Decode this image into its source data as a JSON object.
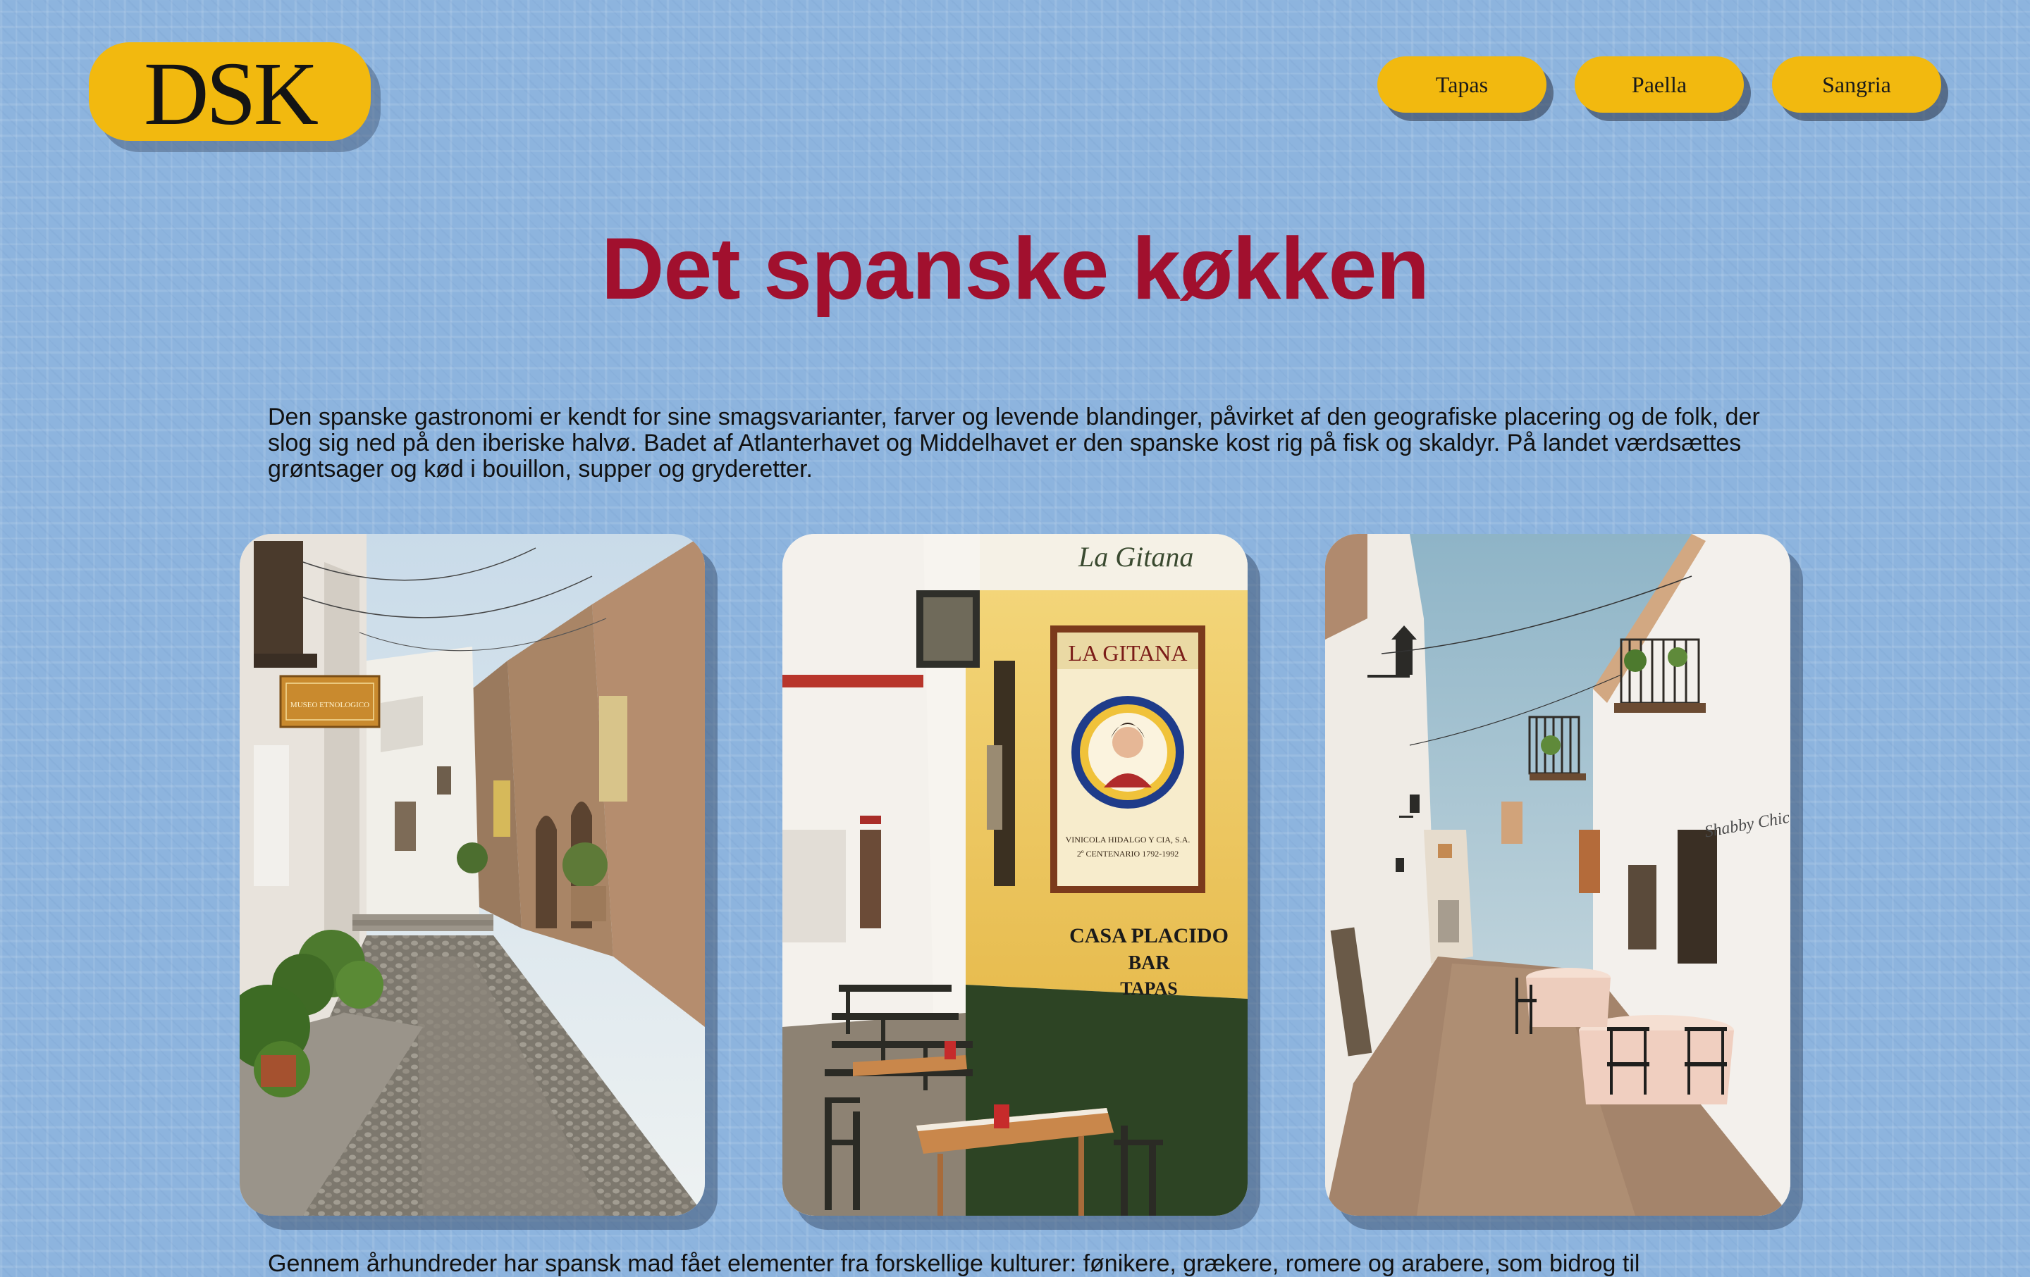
{
  "logo": {
    "text": "DSK"
  },
  "nav": {
    "items": [
      {
        "label": "Tapas"
      },
      {
        "label": "Paella"
      },
      {
        "label": "Sangria"
      }
    ]
  },
  "main": {
    "title": "Det spanske køkken",
    "intro": "Den spanske gastronomi er kendt for sine smagsvarianter, farver og levende blandinger, påvirket af den geografiske placering og de folk, der slog sig ned på den iberiske halvø. Badet af Atlanterhavet og Middelhavet er den spanske kost rig på fisk og skaldyr. På landet værdsættes grøntsager og kød i bouillon, supper og gryderetter.",
    "outro": "Gennem århundreder har spansk mad fået elementer fra forskellige kulturer: fønikere, grækere, romere og arabere, som bidrog til"
  },
  "photos": [
    {
      "sign_text": "MUSEO ETNOLOGICO"
    },
    {
      "tile_title": "LA GITANA",
      "tile_footer": "VINICOLA HIDALGO Y CIA, S.A.",
      "tile_footer_2": "2º CENTENARIO 1792-1992",
      "wall_line_1": "CASA PLACIDO",
      "wall_line_2": "BAR",
      "wall_line_3": "TAPAS",
      "awning_text": "La Gitana"
    },
    {
      "shop_text": "Shabby Chic"
    }
  ],
  "colors": {
    "background": "#8db4de",
    "accent_yellow": "#f2b90f",
    "title_red": "#a1102e"
  }
}
